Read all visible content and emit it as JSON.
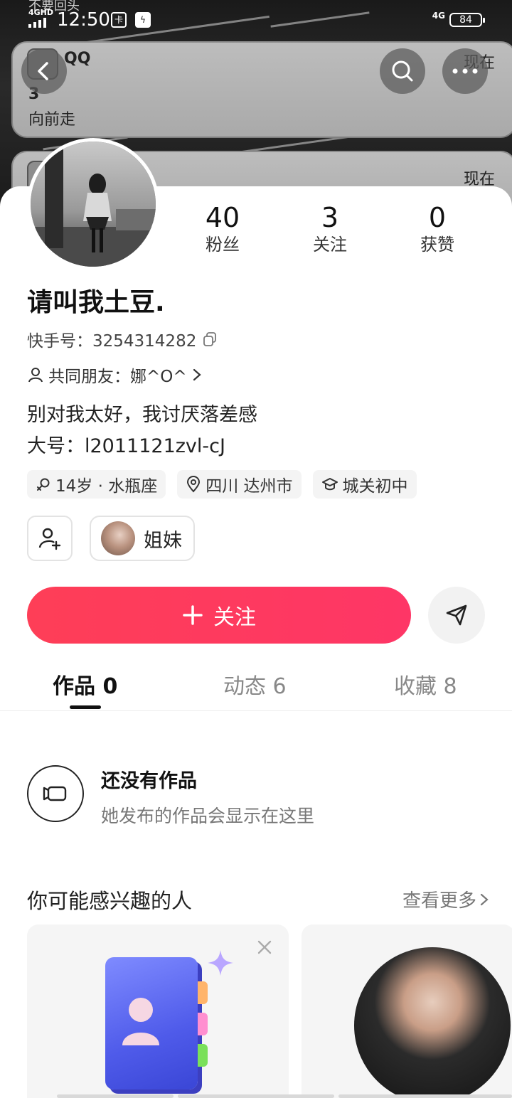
{
  "status_bar": {
    "network": "4GHD",
    "time": "12:50",
    "signal_4g": "4G",
    "battery": "84"
  },
  "background": {
    "top_clipped_text": "不要回头",
    "notification_1": {
      "app": "QQ",
      "time": "现在",
      "title": "3",
      "body": "向前走"
    },
    "notification_2": {
      "time": "现在"
    }
  },
  "toolbar": {
    "back_icon": "chevron-left-icon",
    "search_icon": "search-icon",
    "more_icon": "more-horizontal-icon"
  },
  "profile": {
    "stats": [
      {
        "value": "40",
        "label": "粉丝"
      },
      {
        "value": "3",
        "label": "关注"
      },
      {
        "value": "0",
        "label": "获赞"
      }
    ],
    "name": "请叫我土豆.",
    "kuaishou_id": "快手号：3254314282",
    "mutual_friends": "共同朋友：娜^O^",
    "bio_line_1": "别对我太好，我讨厌落差感",
    "bio_line_2": "大号：l2011121zvl-cJ",
    "tags": [
      "14岁 · 水瓶座",
      "四川 达州市",
      "城关初中"
    ],
    "relation_chip": "姐妹",
    "follow_label": "关注"
  },
  "tabs": [
    {
      "label": "作品 0",
      "active": true
    },
    {
      "label": "动态 6",
      "active": false
    },
    {
      "label": "收藏 8",
      "active": false
    }
  ],
  "empty_state": {
    "title": "还没有作品",
    "subtitle": "她发布的作品会显示在这里"
  },
  "recommend": {
    "title": "你可能感兴趣的人",
    "more": "查看更多"
  },
  "colors": {
    "accent": "#fe3e57",
    "tab_active": "#111111",
    "chip_bg": "#f4f4f4"
  }
}
